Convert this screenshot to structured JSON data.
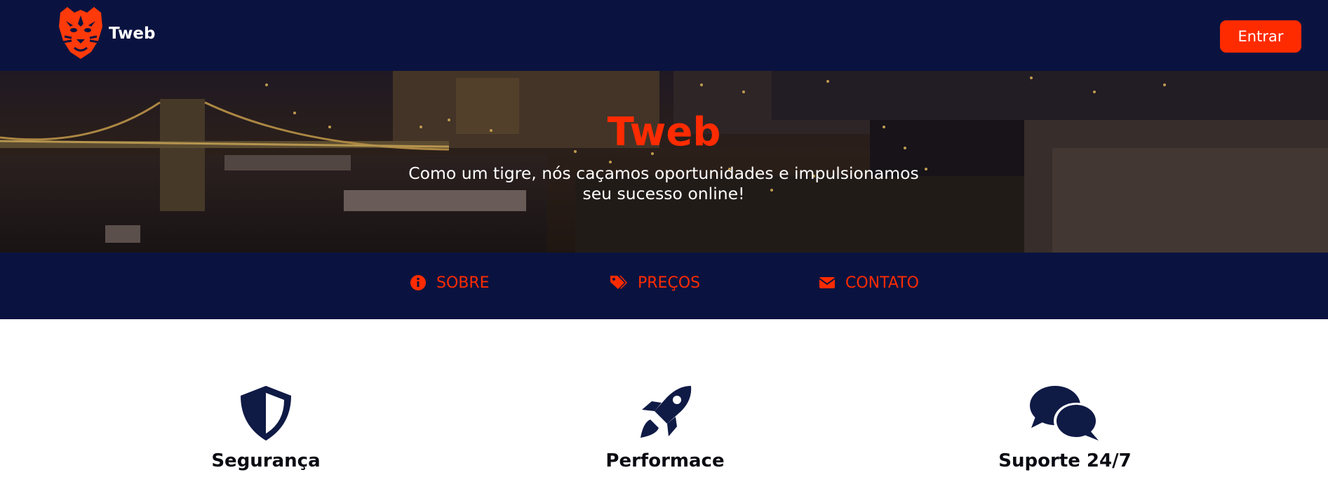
{
  "header": {
    "brand": "Tweb",
    "login_label": "Entrar",
    "logo_icon": "tiger-head-icon"
  },
  "hero": {
    "title": "Tweb",
    "subtitle_line1": "Como um tigre, nós caçamos oportunidades e impulsionamos",
    "subtitle_line2": "seu sucesso online!",
    "background": "night-city-bridge-photo"
  },
  "nav": {
    "items": [
      {
        "label": "SOBRE",
        "icon": "info-circle-icon"
      },
      {
        "label": "PREÇOS",
        "icon": "tags-icon"
      },
      {
        "label": "CONTATO",
        "icon": "envelope-icon"
      }
    ]
  },
  "features": [
    {
      "title": "Segurança",
      "icon": "shield-icon"
    },
    {
      "title": "Performace",
      "icon": "rocket-icon"
    },
    {
      "title": "Suporte 24/7",
      "icon": "chat-bubbles-icon"
    }
  ],
  "colors": {
    "navy": "#0a1340",
    "accent": "#ff2b00",
    "icon_navy": "#0f1a45"
  }
}
